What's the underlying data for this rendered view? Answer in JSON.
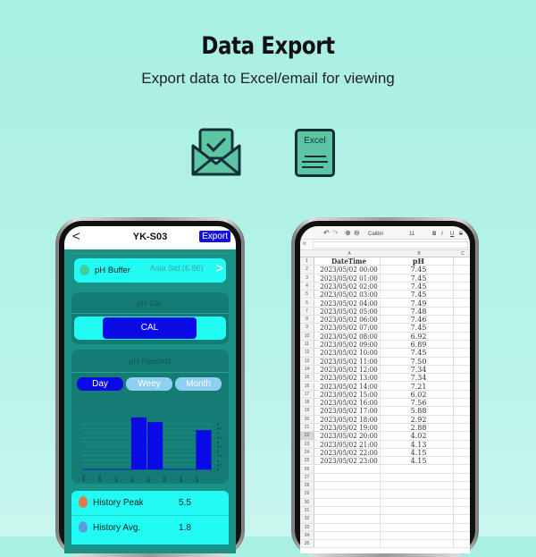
{
  "header": {
    "title": "Data Export",
    "subtitle": "Export data to Excel/email for viewing"
  },
  "icons": {
    "email": "envelope-check-icon",
    "excel": "excel-document-icon",
    "excel_label": "Excel",
    "color": "#5cc6a4"
  },
  "left_phone": {
    "nav": {
      "back": "<",
      "title": "YK-S03",
      "export": "Export"
    },
    "buffer": {
      "label": "pH Buffer",
      "value": "Asia Std.(6.86)",
      "chevron": ">"
    },
    "cal": {
      "section": "pH Cal.",
      "button": "CAL"
    },
    "records": {
      "section": "pH Records",
      "tabs": [
        {
          "label": "Day",
          "active": true
        },
        {
          "label": "Weey",
          "active": false
        },
        {
          "label": "Month",
          "active": false
        }
      ]
    },
    "history": [
      {
        "label": "History Peak",
        "value": "5.5",
        "icon": "drop-flame-icon"
      },
      {
        "label": "History Avg.",
        "value": "1.8",
        "icon": "water-drop-icon"
      }
    ],
    "colors": {
      "teal": "#199186",
      "cyan": "#22fbf4",
      "blue": "#0a0ae6"
    }
  },
  "chart_data": {
    "type": "bar",
    "categories": [
      "4/29",
      "4/30",
      "5/1",
      "5/2",
      "5/3",
      "5/4",
      "5/5",
      "5/6"
    ],
    "values": [
      0,
      0,
      0,
      5.7,
      5.2,
      0,
      0,
      4.3
    ],
    "yticks": [
      "0",
      "0.5",
      "1",
      "1.5",
      "2",
      "2.5",
      "3",
      "3.5",
      "4",
      "4.5",
      "5"
    ],
    "ylim": [
      0,
      5
    ],
    "grid": true,
    "bar_color": "#0a0ae6"
  },
  "right_phone": {
    "toolbar": {
      "font": "Calibri",
      "size": "11",
      "bold": "B",
      "italic": "I",
      "underline": "U",
      "strike": "S",
      "fx": "fx"
    },
    "columns": [
      "A",
      "B",
      "C"
    ],
    "table_header": [
      "DateTime",
      "pH"
    ],
    "rows": [
      [
        "2023/05/02 00:00",
        "7.45"
      ],
      [
        "2023/05/02 01:00",
        "7.45"
      ],
      [
        "2023/05/02 02:00",
        "7.45"
      ],
      [
        "2023/05/02 03:00",
        "7.45"
      ],
      [
        "2023/05/02 04:00",
        "7.49"
      ],
      [
        "2023/05/02 05:00",
        "7.48"
      ],
      [
        "2023/05/02 06:00",
        "7.46"
      ],
      [
        "2023/05/02 07:00",
        "7.45"
      ],
      [
        "2023/05/02 08:00",
        "6.92"
      ],
      [
        "2023/05/02 09:00",
        "6.89"
      ],
      [
        "2023/05/02 10:00",
        "7.45"
      ],
      [
        "2023/05/02 11:00",
        "7.50"
      ],
      [
        "2023/05/02 12:00",
        "7.34"
      ],
      [
        "2023/05/02 13:00",
        "7.34"
      ],
      [
        "2023/05/02 14:00",
        "7.21"
      ],
      [
        "2023/05/02 15:00",
        "6.02"
      ],
      [
        "2023/05/02 16:00",
        "7.56"
      ],
      [
        "2023/05/02 17:00",
        "5.88"
      ],
      [
        "2023/05/02 18:00",
        "2.92"
      ],
      [
        "2023/05/02 19:00",
        "2.88"
      ],
      [
        "2023/05/02 20:00",
        "4.02"
      ],
      [
        "2023/05/02 21:00",
        "4.13"
      ],
      [
        "2023/05/02 22:00",
        "4.15"
      ],
      [
        "2023/05/02 23:00",
        "4.15"
      ]
    ],
    "total_rows": 35
  }
}
